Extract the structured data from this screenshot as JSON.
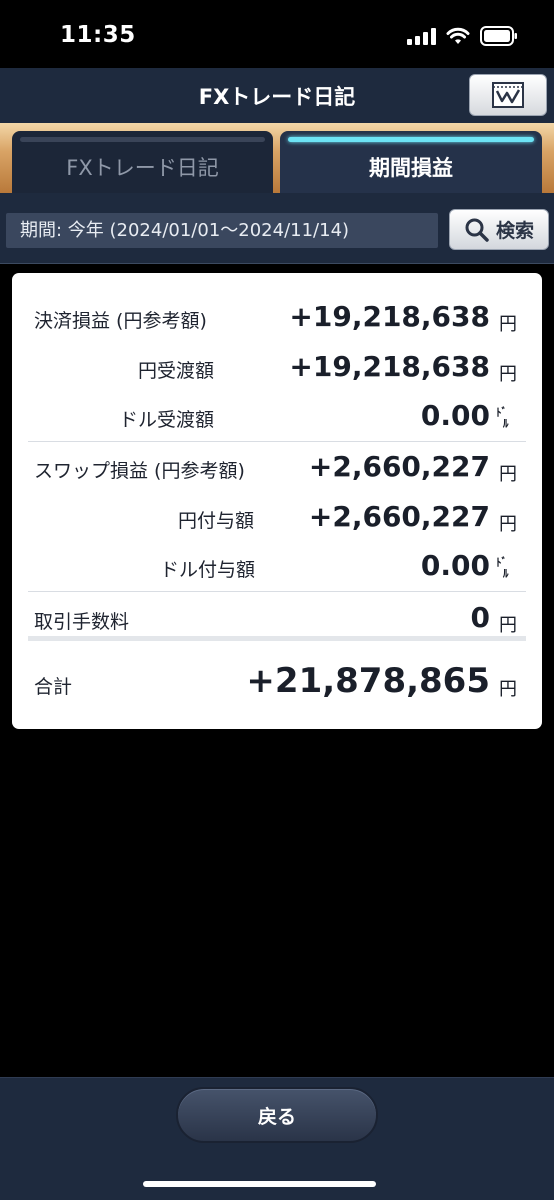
{
  "status_bar": {
    "time": "11:35"
  },
  "header": {
    "title": "FXトレード日記",
    "chart_button_icon": "chart-icon"
  },
  "tabs": [
    {
      "label": "FXトレード日記",
      "active": false
    },
    {
      "label": "期間損益",
      "active": true
    }
  ],
  "period": {
    "text": "期間: 今年 (2024/01/01～2024/11/14)",
    "search_label": "検索"
  },
  "summary": {
    "settlement": {
      "label": "決済損益 (円参考額)",
      "value": "+19,218,638",
      "unit": "円"
    },
    "yen_received": {
      "label": "円受渡額",
      "value": "+19,218,638",
      "unit": "円"
    },
    "dollar_received": {
      "label": "ドル受渡額",
      "value": "0.00",
      "unit_top": "ﾄﾞ",
      "unit_bottom": "ﾙ"
    },
    "swap": {
      "label": "スワップ損益 (円参考額)",
      "value": "+2,660,227",
      "unit": "円"
    },
    "yen_granted": {
      "label": "円付与額",
      "value": "+2,660,227",
      "unit": "円"
    },
    "dollar_granted": {
      "label": "ドル付与額",
      "value": "0.00",
      "unit_top": "ﾄﾞ",
      "unit_bottom": "ﾙ"
    },
    "fee": {
      "label": "取引手数料",
      "value": "0",
      "unit": "円"
    },
    "total": {
      "label": "合計",
      "value": "+21,878,865",
      "unit": "円"
    }
  },
  "bottom": {
    "back_label": "戻る"
  }
}
